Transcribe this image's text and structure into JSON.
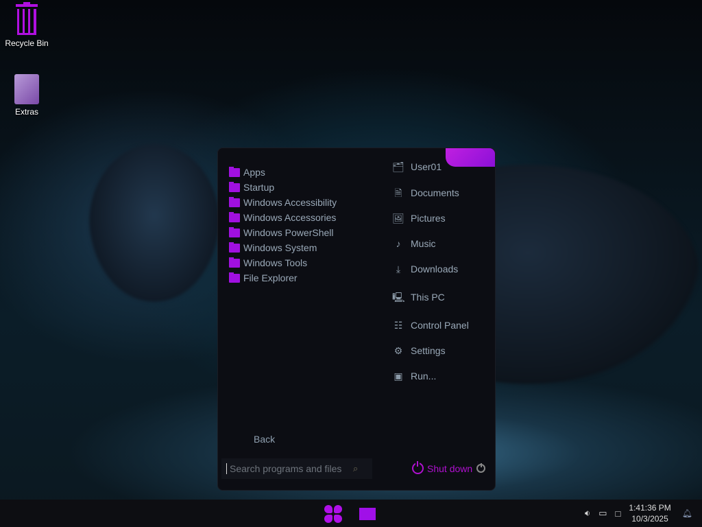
{
  "desktop": {
    "icons": [
      {
        "label": "Recycle Bin",
        "icon": "recycle-bin-icon"
      },
      {
        "label": "Extras",
        "icon": "folder-icon"
      }
    ]
  },
  "start_menu": {
    "programs": [
      "Apps",
      "Startup",
      "Windows Accessibility",
      "Windows Accessories",
      "Windows PowerShell",
      "Windows System",
      "Windows Tools",
      "File Explorer"
    ],
    "places": [
      {
        "label": "User01",
        "icon": "user-folder-icon"
      },
      {
        "label": "Documents",
        "icon": "document-icon"
      },
      {
        "label": "Pictures",
        "icon": "picture-icon"
      },
      {
        "label": "Music",
        "icon": "music-icon"
      },
      {
        "label": "Downloads",
        "icon": "download-icon"
      },
      {
        "label": "This PC",
        "icon": "computer-icon"
      },
      {
        "label": "Control Panel",
        "icon": "control-panel-icon"
      },
      {
        "label": "Settings",
        "icon": "gear-icon"
      },
      {
        "label": "Run...",
        "icon": "run-icon"
      }
    ],
    "back_label": "Back",
    "search_placeholder": "Search programs and files",
    "shutdown_label": "Shut down"
  },
  "taskbar": {
    "time": "1:41:36 PM",
    "date": "10/3/2025"
  },
  "colors": {
    "accent": "#a010e0"
  }
}
